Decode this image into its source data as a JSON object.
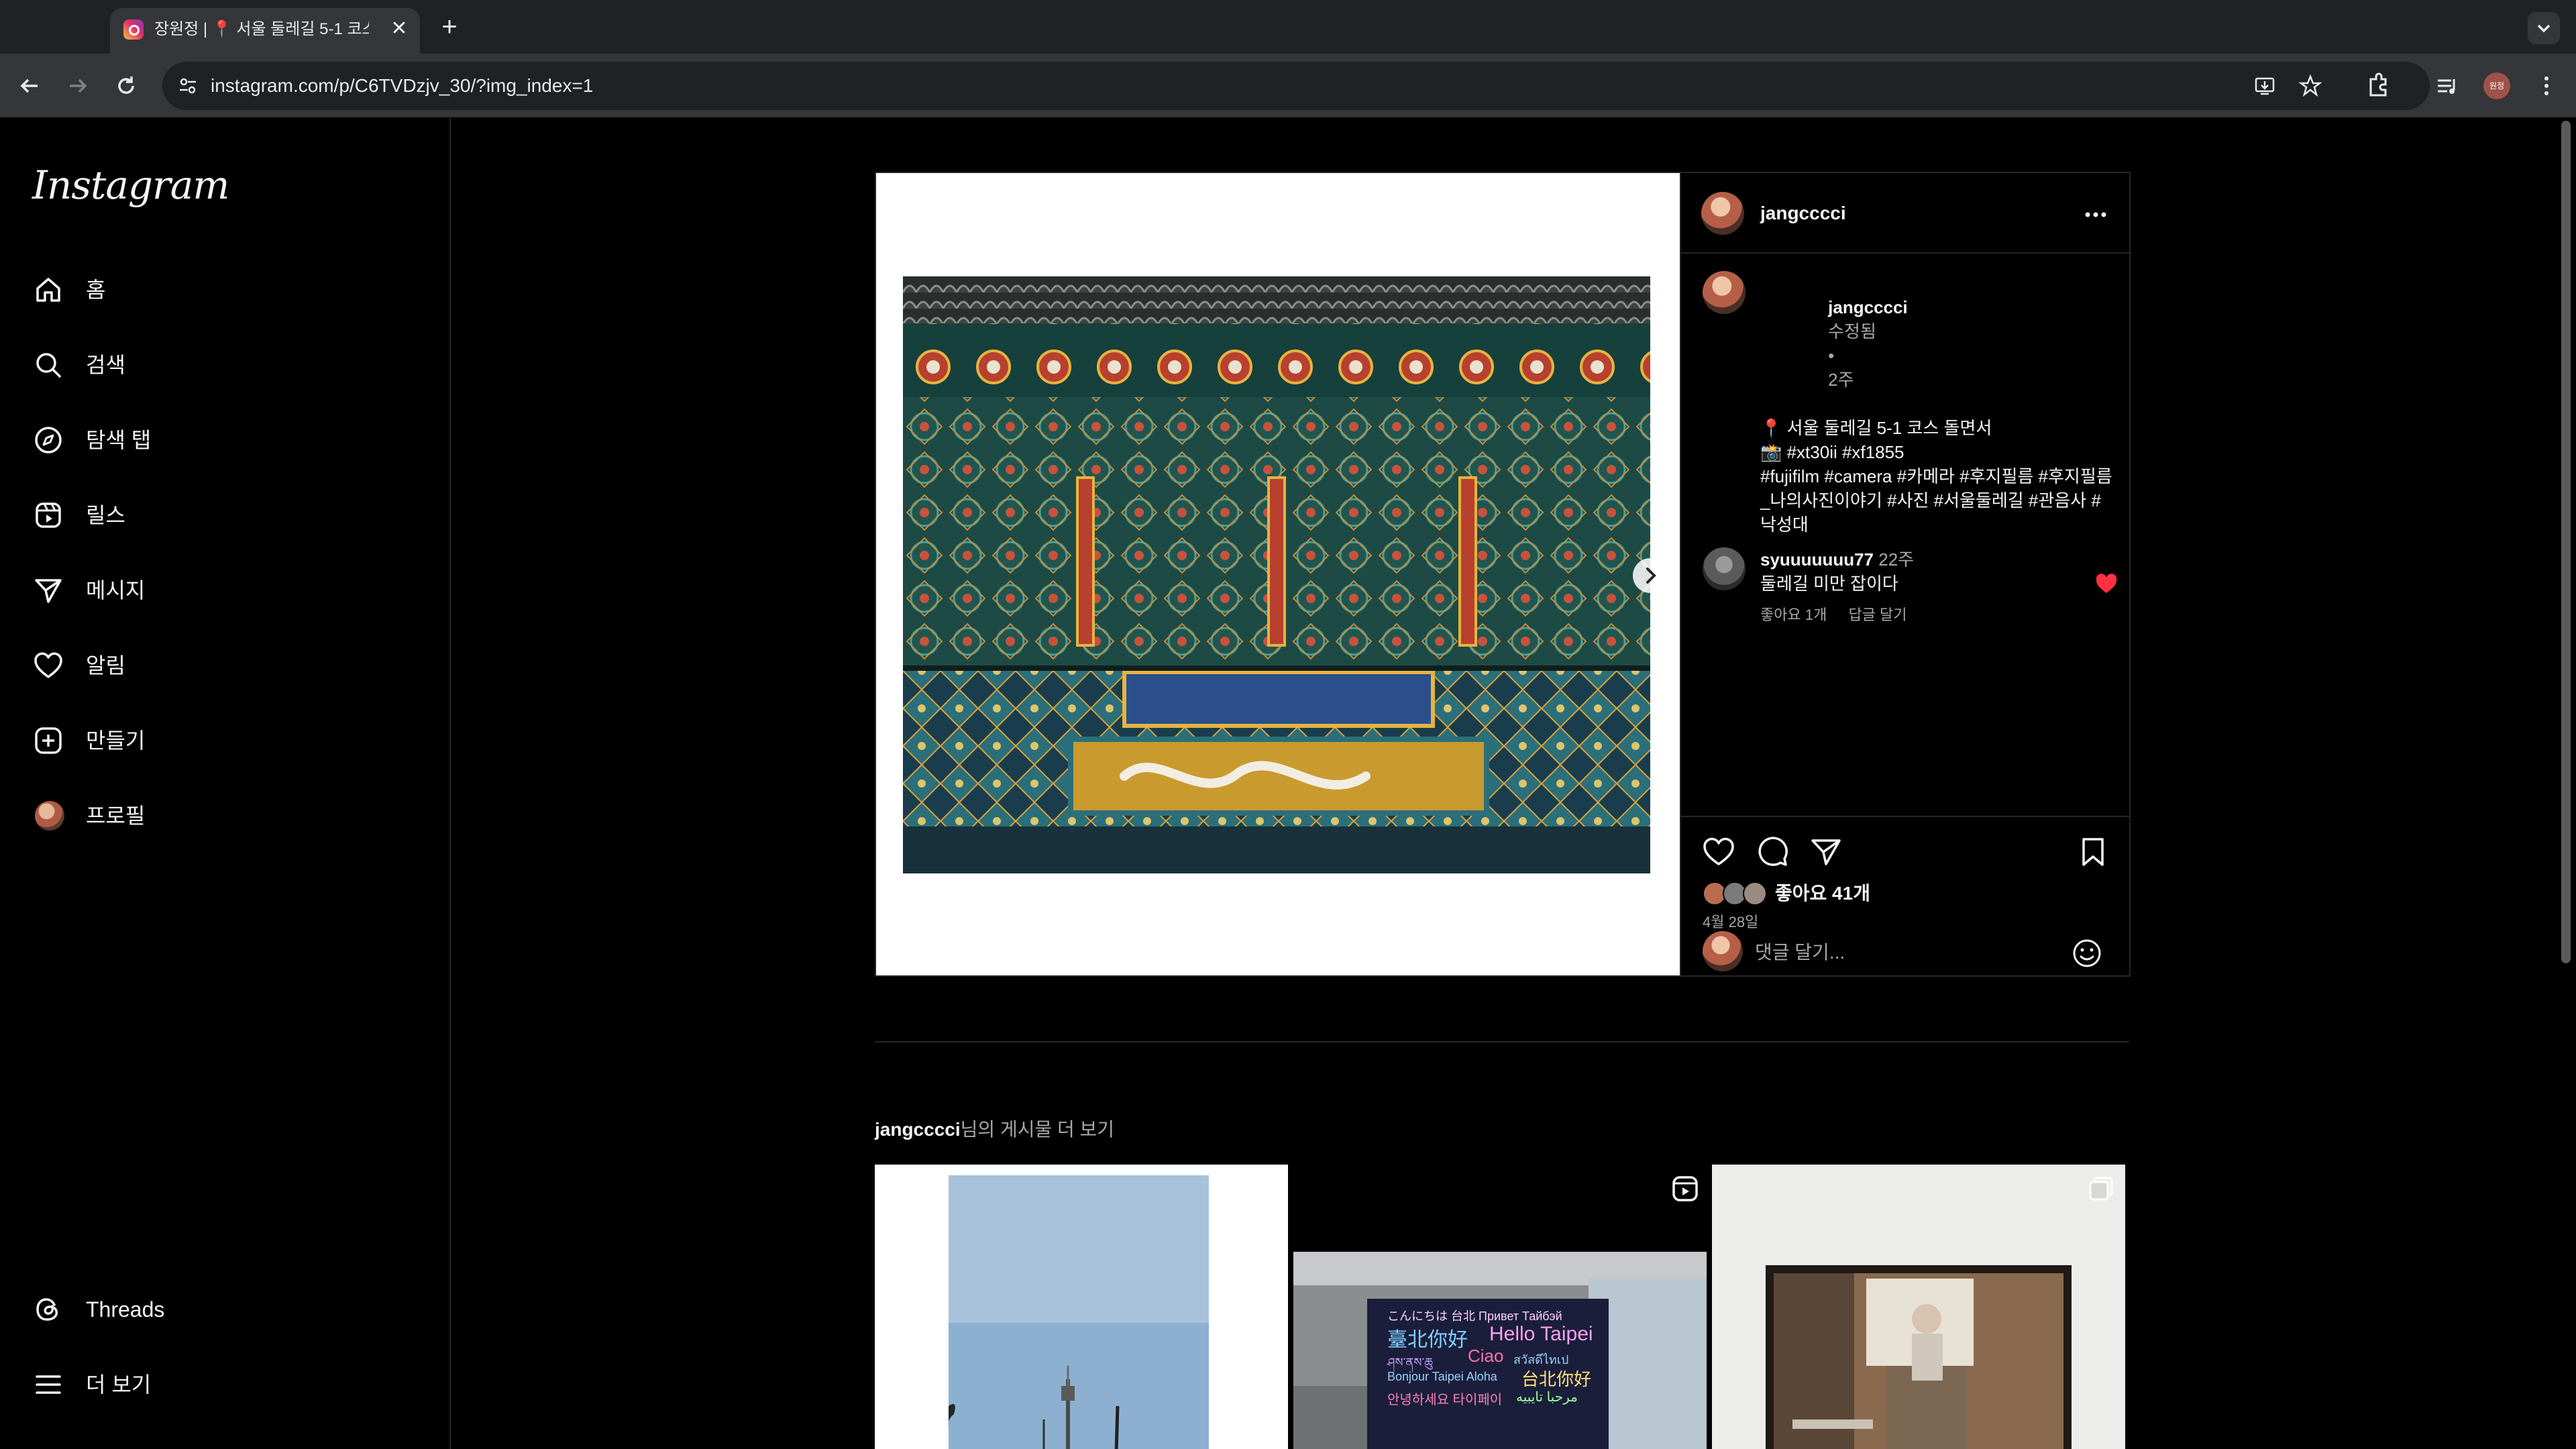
{
  "browser": {
    "tab_title": "장원정 | 📍 서울 둘레길 5-1 코스",
    "url": "instagram.com/p/C6TVDzjv_30/?img_index=1",
    "profile_initials": "원정"
  },
  "sidebar": {
    "logo": "Instagram",
    "items": [
      {
        "label": "홈",
        "icon": "home-icon"
      },
      {
        "label": "검색",
        "icon": "search-icon"
      },
      {
        "label": "탐색 탭",
        "icon": "compass-icon"
      },
      {
        "label": "릴스",
        "icon": "reels-icon"
      },
      {
        "label": "메시지",
        "icon": "send-icon"
      },
      {
        "label": "알림",
        "icon": "heart-icon"
      },
      {
        "label": "만들기",
        "icon": "plus-icon"
      },
      {
        "label": "프로필",
        "icon": "avatar"
      }
    ],
    "bottom": [
      {
        "label": "Threads",
        "icon": "threads-icon"
      },
      {
        "label": "더 보기",
        "icon": "menu-icon"
      }
    ]
  },
  "post": {
    "username": "jangcccci",
    "caption": {
      "username": "jangcccci",
      "edited": "수정됨",
      "separator": "•",
      "age": "2주",
      "lines": [
        "📍 서울 둘레길 5-1 코스 돌면서",
        "",
        "📸 #xt30ii #xf1855",
        "",
        "#fujifilm #camera #카메라 #후지필름 #후지필름_나의사진이야기 #사진 #서울둘레길 #관음사 #낙성대"
      ]
    },
    "comment": {
      "username": "syuuuuuuu77",
      "age": "22주",
      "text": "둘레길 미만 잡이다",
      "likes": "좋아요 1개",
      "reply": "답글 달기"
    },
    "likes_text": "좋아요 41개",
    "date": "4월 28일",
    "comment_placeholder": "댓글 달기..."
  },
  "more_posts": {
    "username": "jangcccci",
    "suffix": "님의 게시물 더 보기"
  },
  "neon_sign": {
    "line1": "こんにちは 台北  Привет Тайбэй",
    "line2a": "臺北你好",
    "line2b": "Hello Taipei",
    "line3a": "ཤས་ནས་ཆུ",
    "line3b": "Ciao",
    "line3c": "สวัสดีไทเป",
    "line4a": "Bonjour Taipei Aloha",
    "line4b": "台北你好",
    "line5a": "안녕하세요 타이페이",
    "line5b": "مرحبا تايبيه"
  },
  "colors": {
    "background": "#000000",
    "border": "#262626",
    "liked_heart": "#ff3040",
    "secondary_text": "#a8a8a8"
  }
}
